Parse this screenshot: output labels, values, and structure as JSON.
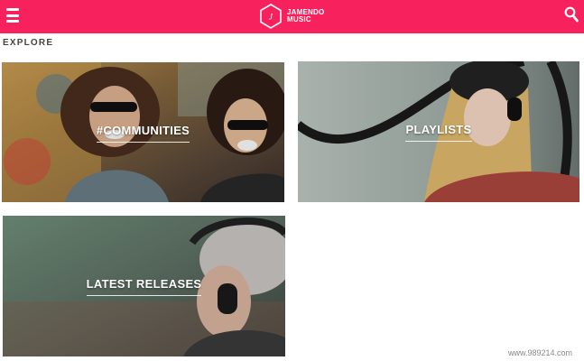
{
  "header": {
    "background": "#f7215d",
    "menu_icon": "hamburger-menu-icon",
    "logo": {
      "line1": "JAMENDO",
      "line2": "MUSIC",
      "mark_text": "J"
    },
    "search_icon": "search-icon"
  },
  "main": {
    "section_title": "EXPLORE",
    "tiles": [
      {
        "label": "#COMMUNITIES"
      },
      {
        "label": "PLAYLISTS"
      },
      {
        "label": "LATEST RELEASES"
      }
    ]
  },
  "watermark": "www.989214.com"
}
